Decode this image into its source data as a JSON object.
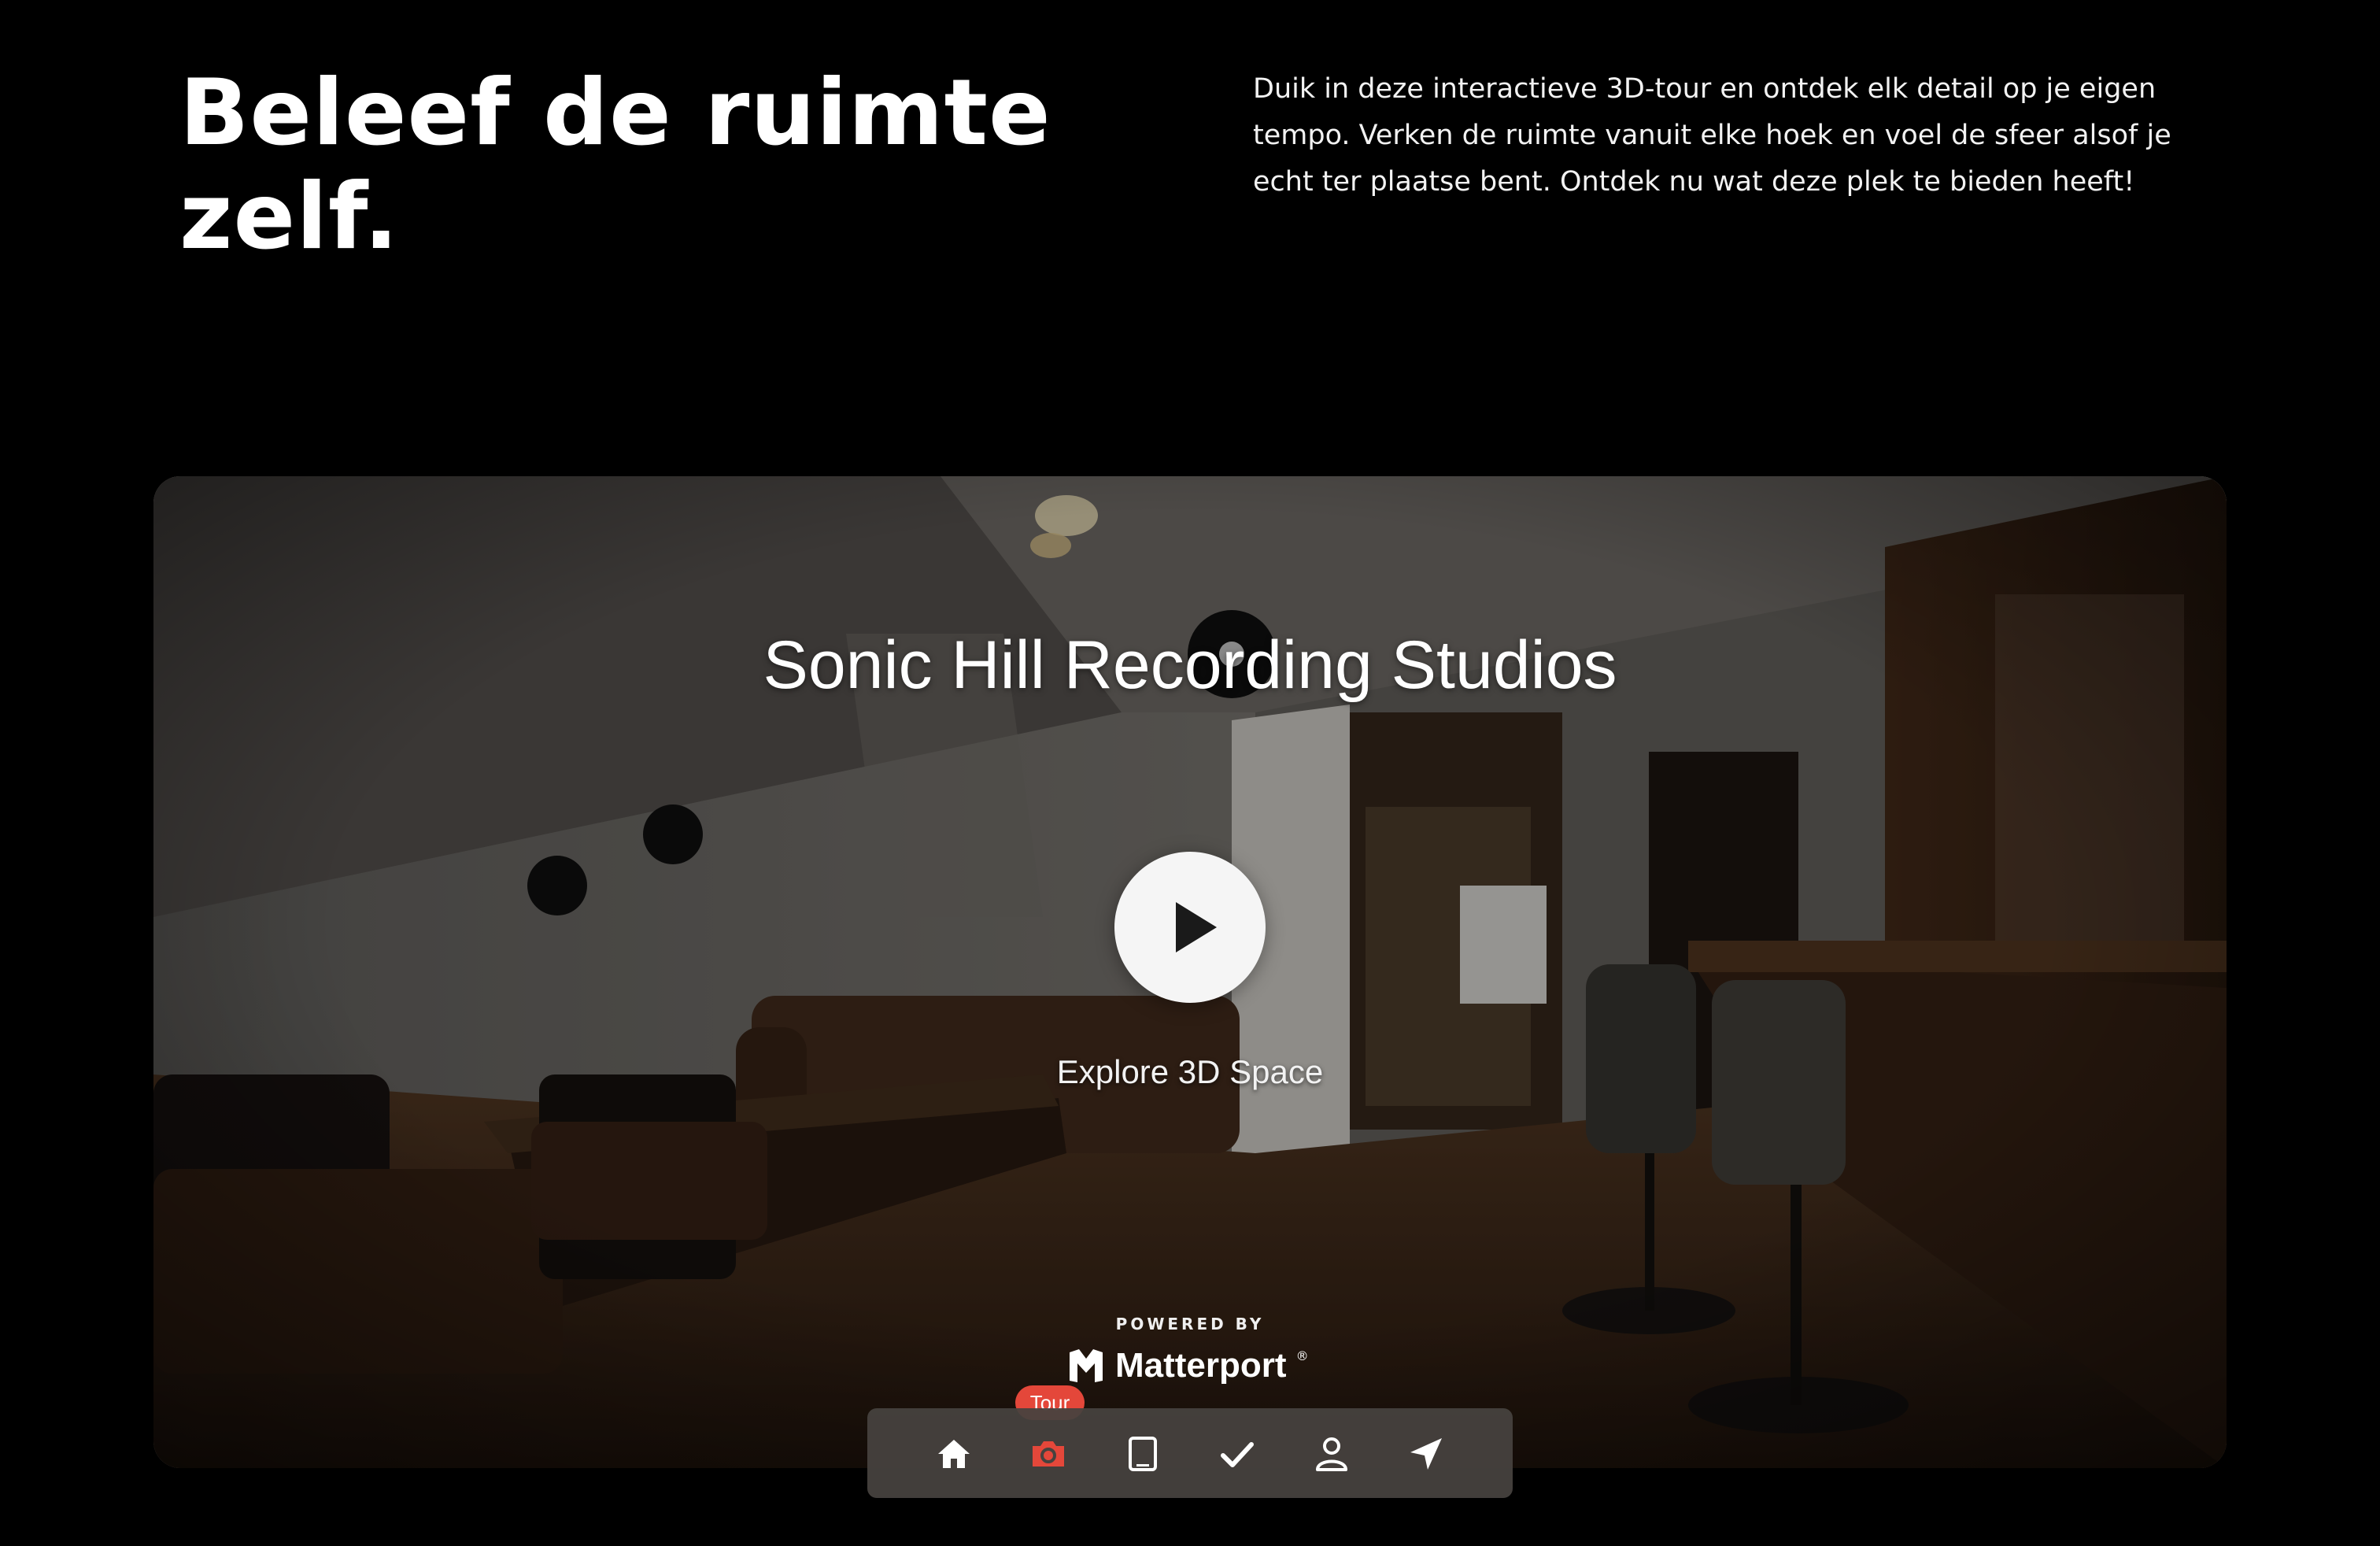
{
  "hero": {
    "headline": "Beleef de ruimte zelf.",
    "intro": "Duik in deze interactieve 3D-tour en ontdek elk detail op je eigen tempo. Verken de ruimte vanuit elke hoek en voel de sfeer alsof je echt ter plaatse bent. Ontdek nu wat deze plek te bieden heeft!"
  },
  "viewer": {
    "title": "Sonic Hill Recording Studios",
    "play_icon": "play-icon",
    "explore_label": "Explore 3D Space",
    "powered_by": "POWERED BY",
    "brand": "Matterport",
    "brand_mark": "®"
  },
  "toolbar": {
    "active_badge": "Tour",
    "items": [
      {
        "icon": "home-icon"
      },
      {
        "icon": "camera-icon",
        "active": true
      },
      {
        "icon": "tablet-icon"
      },
      {
        "icon": "checkmark-icon"
      },
      {
        "icon": "person-icon"
      },
      {
        "icon": "navigation-arrow-icon"
      }
    ]
  },
  "colors": {
    "background": "#000000",
    "accent": "#e4473a",
    "toolbar": "#46423f"
  }
}
